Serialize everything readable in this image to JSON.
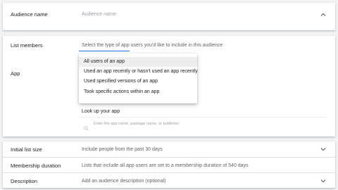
{
  "audience_name": {
    "label": "Audience name",
    "placeholder": "Audience name"
  },
  "list_members": {
    "label": "List members",
    "hint": "Select the type of app users you'd like to include in this audience",
    "options": [
      "All users of an app",
      "Used an app recently or hasn't used an app recently",
      "Used specified versions of an app",
      "Took specific actions within an app"
    ],
    "selected_index": 0
  },
  "app": {
    "label": "App",
    "lookup_label": "Look up your app",
    "search_placeholder": "Enter the app name, package name, or publisher"
  },
  "initial_list_size": {
    "label": "Initial list size",
    "value": "Include people from the past 30 days"
  },
  "membership_duration": {
    "label": "Membership duration",
    "value": "Lists that include all app users are set to a membership duration of 540 days"
  },
  "description": {
    "label": "Description",
    "value": "Add an audience description (optional)"
  },
  "colors": {
    "background": "#f1f3f4",
    "accent": "#1a73e8",
    "text": "#202124",
    "secondary_text": "#5f6368"
  },
  "icons": {
    "collapse": "chevron-up-icon",
    "expand": "chevron-down-icon",
    "search": "search-icon"
  }
}
